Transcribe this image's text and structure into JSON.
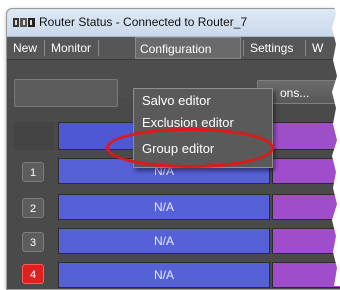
{
  "window": {
    "title": "Router Status - Connected to Router_7",
    "app_icon": "router-app-icon"
  },
  "menubar": {
    "items": [
      "New",
      "Monitor",
      "Configuration",
      "Settings",
      "W"
    ],
    "active": "Configuration"
  },
  "dropdown": {
    "items": [
      "Salvo editor",
      "Exclusion editor",
      "Group editor"
    ],
    "highlighted": "Group editor"
  },
  "toolbar": {
    "options_label": "ons..."
  },
  "grid": {
    "rows": [
      {
        "num": "1",
        "value": "N/A",
        "alert": false
      },
      {
        "num": "2",
        "value": "N/A",
        "alert": false
      },
      {
        "num": "3",
        "value": "N/A",
        "alert": false
      },
      {
        "num": "4",
        "value": "N/A",
        "alert": true
      }
    ]
  },
  "colors": {
    "cell_blue": "#5661d8",
    "cell_purple": "#a04dcc",
    "alert_red": "#e02020",
    "highlight_ring": "#e01818"
  }
}
